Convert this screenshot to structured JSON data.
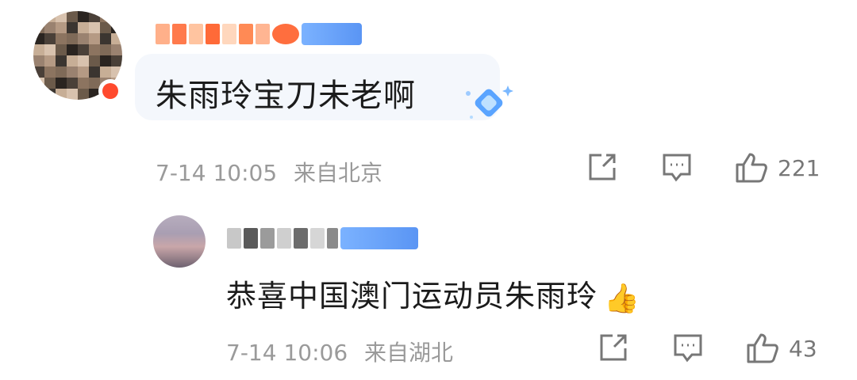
{
  "comment": {
    "text": "朱雨玲宝刀未老啊",
    "date": "7-14 10:05",
    "location": "来自北京",
    "likes": "221"
  },
  "reply": {
    "text": "恭喜中国澳门运动员朱雨玲",
    "date": "7-14 10:06",
    "location": "来自湖北",
    "likes": "43"
  },
  "icons": {
    "share": "share-icon",
    "comment": "comment-icon",
    "like": "like-icon",
    "emoji": "thumbs-up-emoji"
  },
  "colors": {
    "meta_text": "#9a9a9a",
    "badge_blue": "#5a95f4",
    "bubble_bg": "#f4f7fc"
  }
}
